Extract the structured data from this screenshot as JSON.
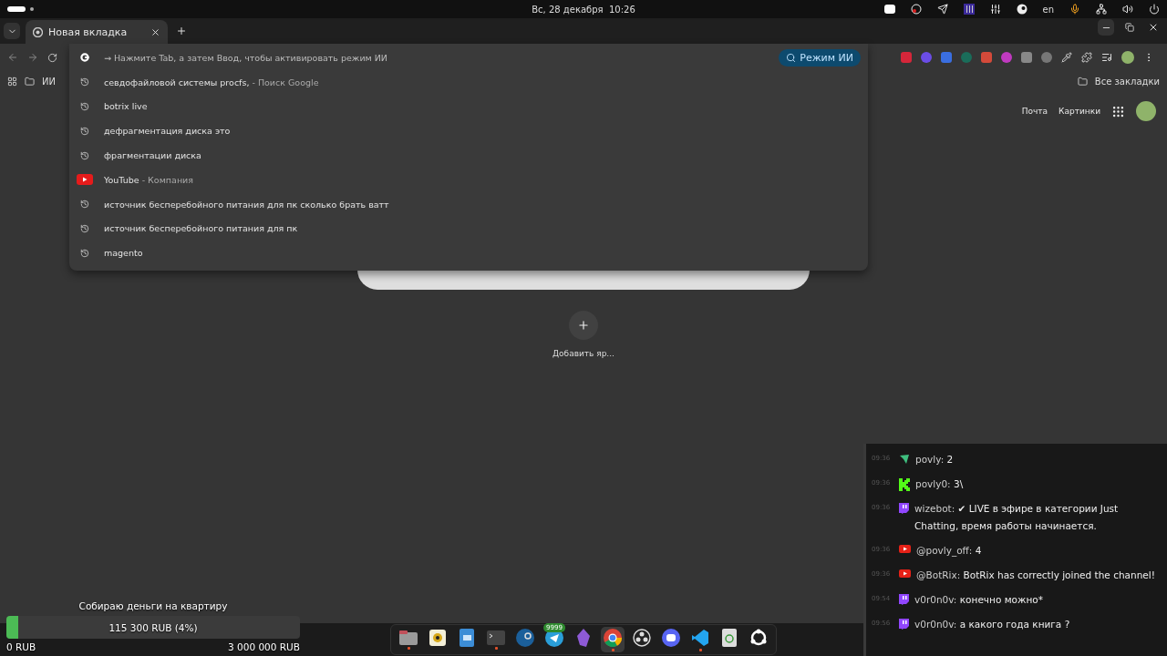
{
  "top_bar": {
    "date_time": "Вс, 28 декабря  10:26",
    "language": "en"
  },
  "tabs": [
    {
      "title": "Новая вкладка",
      "selected": true
    }
  ],
  "omnibox": {
    "hint": "→ Нажмите Tab, а затем Ввод, чтобы активировать режим ИИ",
    "ai_mode_button": "Режим ИИ"
  },
  "suggestions": [
    {
      "kind": "history",
      "text": "севдофайловой системы procfs,",
      "suffix": "- Поиск Google"
    },
    {
      "kind": "history",
      "text": "botrix live"
    },
    {
      "kind": "history",
      "text": "дефрагментация диска это"
    },
    {
      "kind": "history",
      "text": "фрагментации диска"
    },
    {
      "kind": "site",
      "text": "YouTube",
      "suffix": "- Компания"
    },
    {
      "kind": "history",
      "text": "источник бесперебойного питания для пк сколько брать ватт"
    },
    {
      "kind": "history",
      "text": "источник бесперебойного питания для пк"
    },
    {
      "kind": "history",
      "text": "magento"
    }
  ],
  "bookmarks_bar": {
    "folder": "ИИ",
    "all_bookmarks": "Все закладки"
  },
  "new_tab_page": {
    "links": [
      "Почта",
      "Картинки"
    ],
    "add_shortcut": "Добавить яр..."
  },
  "chat": [
    {
      "time": "09:36",
      "kind": "leaf",
      "user": "povly:",
      "text": "2"
    },
    {
      "time": "09:36",
      "kind": "kick",
      "user": "povly0:",
      "text": "3\\"
    },
    {
      "time": "09:36",
      "kind": "twitch",
      "user": "wizebot:",
      "text": "✔ LIVE в эфире в категории Just Chatting, время работы начинается."
    },
    {
      "time": "09:36",
      "kind": "youtube",
      "user": "@povly_off:",
      "text": "4"
    },
    {
      "time": "09:36",
      "kind": "youtube",
      "user": "@BotRix:",
      "text": "BotRix has correctly joined the channel!"
    },
    {
      "time": "09:54",
      "kind": "twitch",
      "user": "v0r0n0v:",
      "text": "конечно можно*"
    },
    {
      "time": "09:56",
      "kind": "twitch",
      "user": "v0r0n0v:",
      "text": "а какого года книга ?"
    }
  ],
  "donation": {
    "title": "Собираю деньги на квартиру",
    "amount": "115 300 RUB (4%)",
    "level": 0.04,
    "min": "0 RUB",
    "max": "3 000 000 RUB"
  },
  "dock": [
    {
      "kind": "files",
      "running": true,
      "selected": false
    },
    {
      "kind": "player",
      "running": false,
      "selected": false
    },
    {
      "kind": "writer",
      "running": false,
      "selected": false
    },
    {
      "kind": "terminal",
      "running": true,
      "selected": false
    },
    {
      "kind": "steam",
      "running": false,
      "selected": false
    },
    {
      "kind": "telegram",
      "running": false,
      "selected": false,
      "badge": "9999"
    },
    {
      "kind": "crystal",
      "running": false,
      "selected": false
    },
    {
      "kind": "chrome",
      "running": true,
      "selected": true
    },
    {
      "kind": "obs",
      "running": false,
      "selected": false
    },
    {
      "kind": "discord",
      "running": false,
      "selected": false
    },
    {
      "kind": "vscode",
      "running": true,
      "selected": false
    },
    {
      "kind": "trash",
      "running": false,
      "selected": false
    },
    {
      "kind": "apps",
      "running": false,
      "selected": false
    }
  ]
}
